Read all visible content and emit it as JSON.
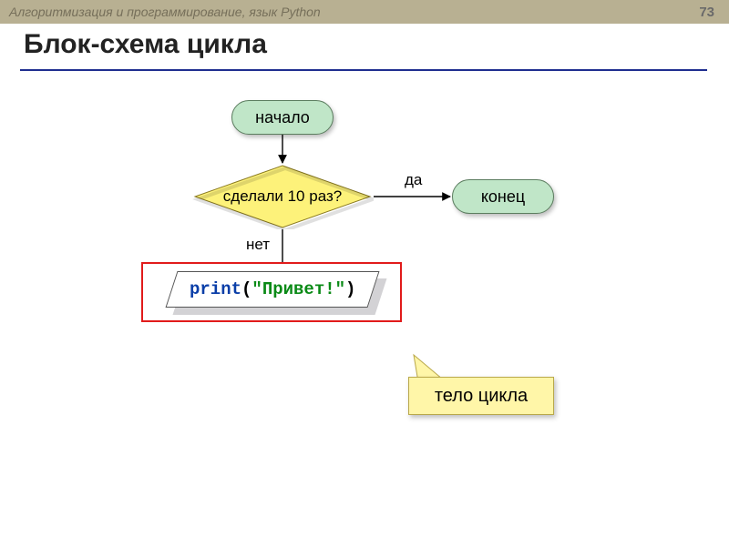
{
  "header": {
    "course": "Алгоритмизация и программирование, язык Python",
    "page": "73"
  },
  "title": "Блок-схема цикла",
  "flow": {
    "start": "начало",
    "end": "конец",
    "decision": "сделали 10 раз?",
    "yes": "да",
    "no": "нет",
    "process": {
      "func": "print",
      "open": "(",
      "str": "\"Привет!\"",
      "close": ")"
    }
  },
  "callout": "тело цикла",
  "chart_data": {
    "type": "flowchart",
    "nodes": [
      {
        "id": "start",
        "kind": "terminal",
        "label": "начало"
      },
      {
        "id": "cond",
        "kind": "decision",
        "label": "сделали 10 раз?"
      },
      {
        "id": "proc",
        "kind": "process",
        "label": "print(\"Привет!\")"
      },
      {
        "id": "end",
        "kind": "terminal",
        "label": "конец"
      }
    ],
    "edges": [
      {
        "from": "start",
        "to": "cond",
        "label": ""
      },
      {
        "from": "cond",
        "to": "end",
        "label": "да"
      },
      {
        "from": "cond",
        "to": "proc",
        "label": "нет"
      },
      {
        "from": "proc",
        "to": "cond",
        "label": ""
      }
    ],
    "annotations": [
      {
        "target": "proc",
        "text": "тело цикла"
      }
    ]
  }
}
